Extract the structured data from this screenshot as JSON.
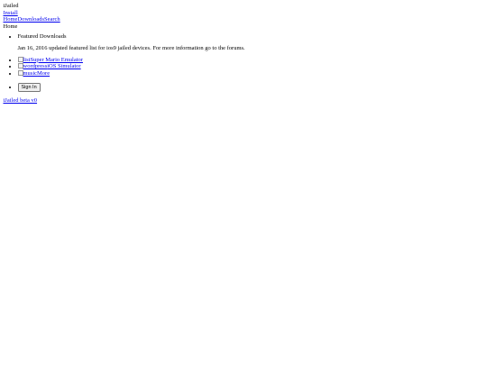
{
  "header": {
    "site_title": "iJailed",
    "install_link": "Install"
  },
  "nav": {
    "home": "Home",
    "downloads": "Downloads",
    "search": "Search"
  },
  "breadcrumb": "Home",
  "featured": {
    "heading": "Featured Downloads",
    "description": "Jan 16, 2016 updated featured list for ios9 jailed devices. For more information go to the forums."
  },
  "downloads": [
    {
      "img_alt": "list",
      "label": "Super Mario Emulator",
      "icon": "broken-image-icon"
    },
    {
      "img_alt": "wordpress",
      "label": "iOS Simulator",
      "icon": "broken-image-icon"
    },
    {
      "img_alt": "music",
      "label": "More",
      "icon": "broken-image-icon"
    }
  ],
  "auth": {
    "sign_in_label": "Sign In"
  },
  "footer": {
    "link": "iJailed beta v0"
  }
}
